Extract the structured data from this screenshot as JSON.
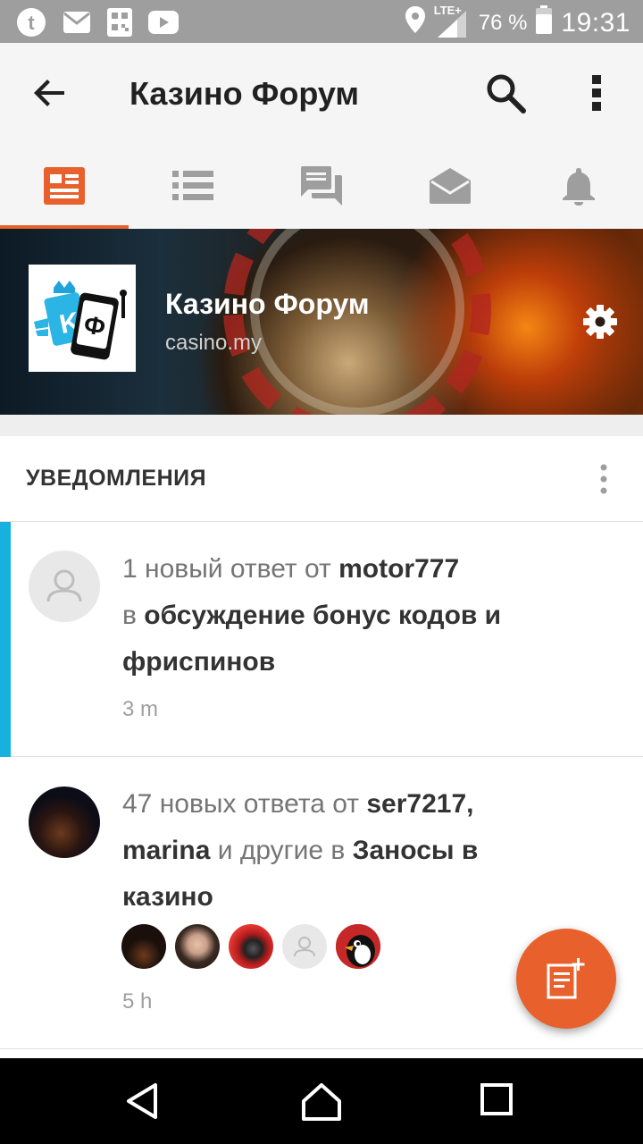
{
  "status_bar": {
    "icons_left": [
      "tumblr-icon",
      "mail-icon",
      "qr-code-icon",
      "youtube-icon"
    ],
    "icons_right": [
      "location-icon",
      "lte-signal-icon",
      "battery-icon"
    ],
    "network": "LTE+",
    "battery": "76 %",
    "time": "19:31"
  },
  "toolbar": {
    "title": "Казино Форум",
    "actions": [
      "back-icon",
      "search-icon",
      "more-vert-icon"
    ]
  },
  "tabs": [
    {
      "icon": "feed-icon",
      "active": true
    },
    {
      "icon": "list-icon",
      "active": false
    },
    {
      "icon": "forum-icon",
      "active": false
    },
    {
      "icon": "mail-open-icon",
      "active": false
    },
    {
      "icon": "bell-icon",
      "active": false
    }
  ],
  "banner": {
    "name": "Казино Форум",
    "url": "casino.my"
  },
  "notifications_section": {
    "title": "УВЕДОМЛЕНИЯ"
  },
  "notifications": [
    {
      "unread": true,
      "pre": "1 новый ответ от ",
      "user": "motor777",
      "mid": "в ",
      "topic": "обсуждение бонус кодов и фриспинов",
      "time": "3 m"
    },
    {
      "unread": false,
      "pre": "47 новых ответа от ",
      "user1": "ser7217,",
      "user2": "marina",
      "mid": " и другие в ",
      "topic": "Заносы в казино",
      "time": "5 h"
    }
  ],
  "colors": {
    "accent": "#e8612c",
    "unread": "#17b1de",
    "status_bar": "#9e9e9e"
  }
}
